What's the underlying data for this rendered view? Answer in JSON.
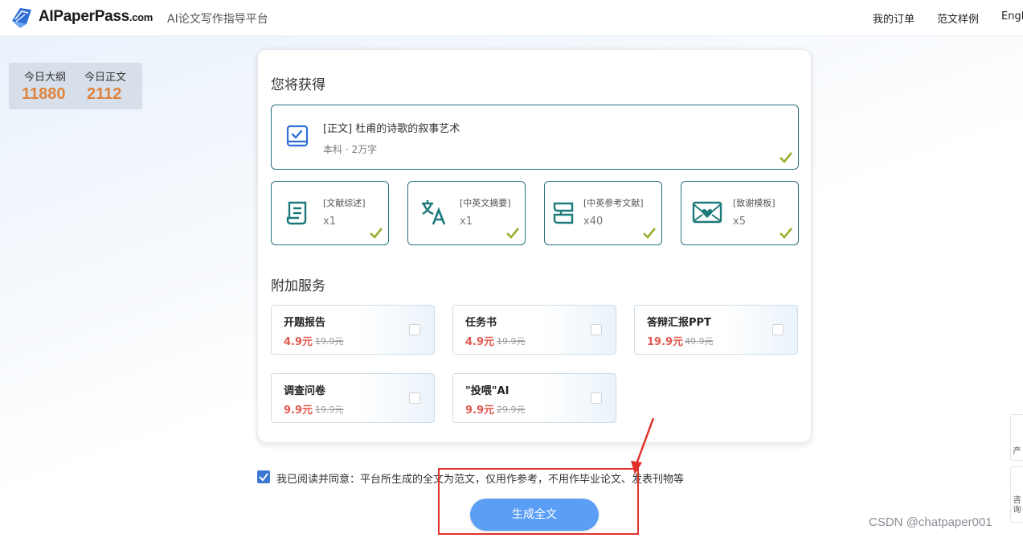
{
  "header": {
    "brand": "AIPaperPass",
    "brand_domain": ".com",
    "tagline": "AI论文写作指导平台",
    "nav": [
      "我的订单",
      "范文样例",
      "Engl"
    ]
  },
  "stats": {
    "outline_label": "今日大纲",
    "outline_value": "11880",
    "body_label": "今日正文",
    "body_value": "2112"
  },
  "card": {
    "get_title": "您将获得",
    "main_item": {
      "title": "[正文] 杜甫的诗歌的叙事艺术",
      "subtitle": "本科 · 2万字"
    },
    "items": [
      {
        "label": "[文献综述]",
        "count": "x1",
        "icon": "document-list-icon"
      },
      {
        "label": "[中英文摘要]",
        "count": "x1",
        "icon": "translate-icon"
      },
      {
        "label": "[中英参考文献]",
        "count": "x40",
        "icon": "book-reference-icon"
      },
      {
        "label": "[致谢模板]",
        "count": "x5",
        "icon": "heart-envelope-icon"
      }
    ],
    "extra_title": "附加服务",
    "services": [
      {
        "name": "开题报告",
        "price": "4.9元",
        "old": "19.9元"
      },
      {
        "name": "任务书",
        "price": "4.9元",
        "old": "19.9元"
      },
      {
        "name": "答辩汇报PPT",
        "price": "19.9元",
        "old": "49.9元"
      },
      {
        "name": "调查问卷",
        "price": "9.9元",
        "old": "19.9元"
      },
      {
        "name": "\"投喂\"AI",
        "price": "9.9元",
        "old": "29.9元"
      }
    ]
  },
  "agreement": "我已阅读并同意：平台所生成的全文为范文，仅用作参考，不用作毕业论文、发表刊物等",
  "generate_button": "生成全文",
  "side_tabs": [
    "产",
    "咨询"
  ],
  "watermark": "CSDN @chatpaper001",
  "colors": {
    "accent": "#5b9ef5",
    "tile_border": "#2a6f7f",
    "price": "#e05a4f",
    "stat_value": "#e0823d",
    "check": "#9aae2d",
    "annotation": "#e0312a"
  }
}
